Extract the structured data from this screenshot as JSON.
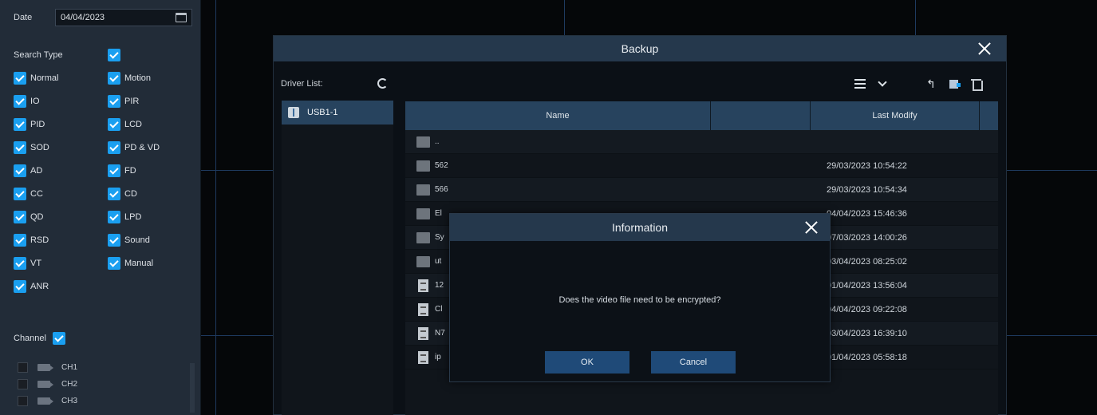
{
  "left_panel": {
    "date_label": "Date",
    "date_value": "04/04/2023",
    "search_type_label": "Search Type",
    "search_types": [
      {
        "label": "Normal",
        "checked": true
      },
      {
        "label": "Motion",
        "checked": true
      },
      {
        "label": "IO",
        "checked": true
      },
      {
        "label": "PIR",
        "checked": true
      },
      {
        "label": "PID",
        "checked": true
      },
      {
        "label": "LCD",
        "checked": true
      },
      {
        "label": "SOD",
        "checked": true
      },
      {
        "label": "PD & VD",
        "checked": true
      },
      {
        "label": "AD",
        "checked": true
      },
      {
        "label": "FD",
        "checked": true
      },
      {
        "label": "CC",
        "checked": true
      },
      {
        "label": "CD",
        "checked": true
      },
      {
        "label": "QD",
        "checked": true
      },
      {
        "label": "LPD",
        "checked": true
      },
      {
        "label": "RSD",
        "checked": true
      },
      {
        "label": "Sound",
        "checked": true
      },
      {
        "label": "VT",
        "checked": true
      },
      {
        "label": "Manual",
        "checked": true
      },
      {
        "label": "ANR",
        "checked": true
      }
    ],
    "channel_label": "Channel",
    "channels": [
      "CH1",
      "CH2",
      "CH3"
    ]
  },
  "backup": {
    "title": "Backup",
    "driver_list_label": "Driver List:",
    "drivers": [
      "USB1-1"
    ],
    "columns": {
      "name": "Name",
      "last_modify": "Last Modify"
    },
    "rows": [
      {
        "type": "folder",
        "name": "..",
        "modified": ""
      },
      {
        "type": "folder",
        "name": "562",
        "modified": "29/03/2023 10:54:22"
      },
      {
        "type": "folder",
        "name": "566",
        "modified": "29/03/2023 10:54:34"
      },
      {
        "type": "folder",
        "name": "El",
        "modified": "04/04/2023 15:46:36"
      },
      {
        "type": "folder",
        "name": "Sy",
        "modified": "07/03/2023 14:00:26"
      },
      {
        "type": "folder",
        "name": "ut",
        "modified": "03/04/2023 08:25:02"
      },
      {
        "type": "file",
        "name": "12",
        "modified": "01/04/2023 13:56:04"
      },
      {
        "type": "file",
        "name": "Cl",
        "modified": "04/04/2023 09:22:08"
      },
      {
        "type": "file",
        "name": "N7",
        "modified": "03/04/2023 16:39:10"
      },
      {
        "type": "file",
        "name": "ip",
        "modified": "01/04/2023 05:58:18"
      }
    ]
  },
  "info_dialog": {
    "title": "Information",
    "message": "Does the video file need to be encrypted?",
    "ok_label": "OK",
    "cancel_label": "Cancel"
  },
  "colors": {
    "accent": "#1a9ff0",
    "title_bar": "#25384c",
    "button": "#1f4a78",
    "selected_row": "#27435e"
  },
  "icons": [
    "calendar-icon",
    "refresh-icon",
    "usb-icon",
    "list-view-icon",
    "chevron-down-icon",
    "back-icon",
    "new-folder-icon",
    "trash-icon",
    "close-icon",
    "folder-icon",
    "file-icon",
    "camera-icon"
  ]
}
